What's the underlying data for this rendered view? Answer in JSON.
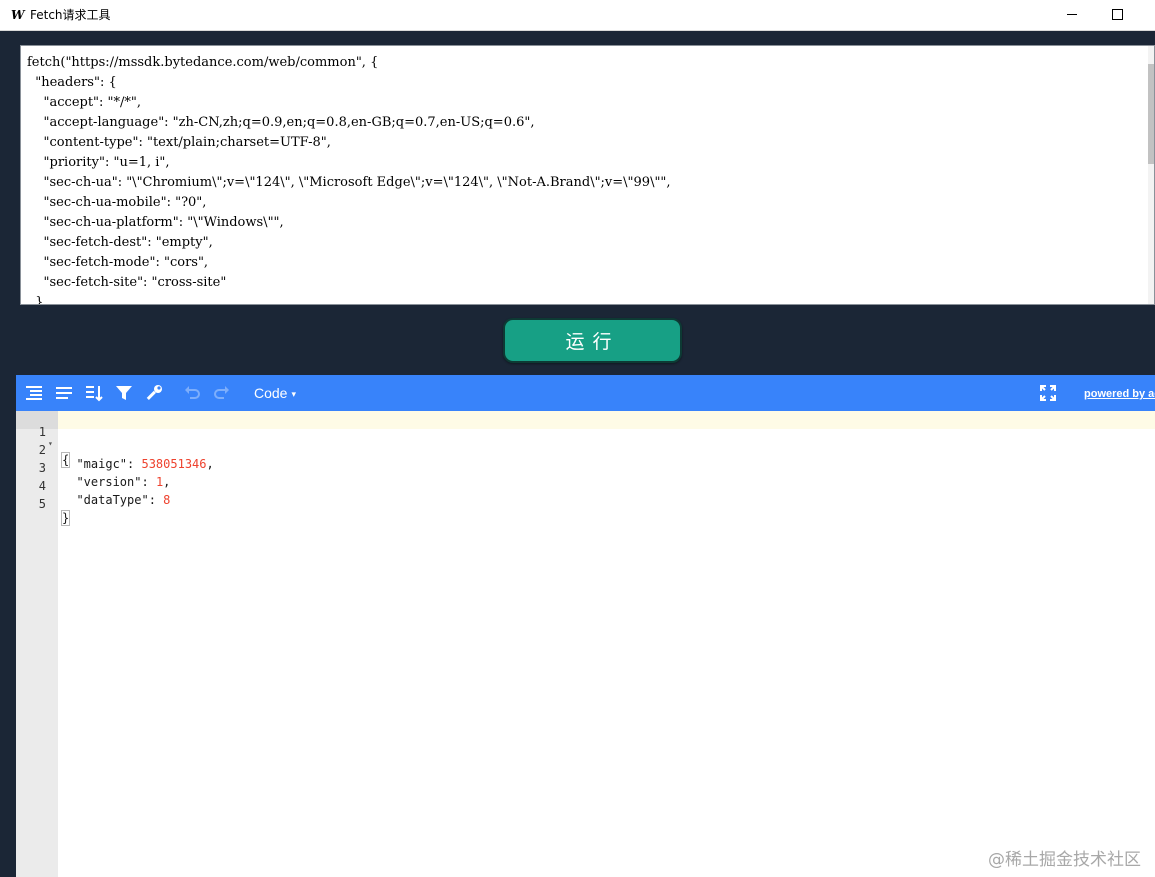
{
  "window": {
    "icon_letter": "W",
    "title": "Fetch请求工具"
  },
  "request": {
    "text": "fetch(\"https://mssdk.bytedance.com/web/common\", {\n  \"headers\": {\n    \"accept\": \"*/*\",\n    \"accept-language\": \"zh-CN,zh;q=0.9,en;q=0.8,en-GB;q=0.7,en-US;q=0.6\",\n    \"content-type\": \"text/plain;charset=UTF-8\",\n    \"priority\": \"u=1, i\",\n    \"sec-ch-ua\": \"\\\"Chromium\\\";v=\\\"124\\\", \\\"Microsoft Edge\\\";v=\\\"124\\\", \\\"Not-A.Brand\\\";v=\\\"99\\\"\",\n    \"sec-ch-ua-mobile\": \"?0\",\n    \"sec-ch-ua-platform\": \"\\\"Windows\\\"\",\n    \"sec-fetch-dest\": \"empty\",\n    \"sec-fetch-mode\": \"cors\",\n    \"sec-fetch-site\": \"cross-site\"\n  },"
  },
  "run_button": {
    "label": "运行"
  },
  "json_editor": {
    "toolbar": {
      "mode_label": "Code",
      "mode_caret": "▾",
      "powered_by": "powered by ace",
      "icons": [
        "format-icon",
        "compact-icon",
        "sort-icon",
        "filter-icon",
        "repair-icon",
        "undo-icon",
        "redo-icon",
        "fullscreen-icon"
      ]
    },
    "lines": [
      {
        "num": "1",
        "text": "{"
      },
      {
        "num": "2",
        "key": "\"maigc\"",
        "sep": ": ",
        "value": "538051346",
        "tail": ","
      },
      {
        "num": "3",
        "key": "\"version\"",
        "sep": ": ",
        "value": "1",
        "tail": ","
      },
      {
        "num": "4",
        "key": "\"dataType\"",
        "sep": ": ",
        "value": "8",
        "tail": ""
      },
      {
        "num": "5",
        "text": "}"
      }
    ]
  },
  "watermark": "@稀土掘金技术社区",
  "colors": {
    "background": "#1b2636",
    "toolbar": "#3883fa",
    "run_button": "#17a085",
    "number": "#ee422e"
  }
}
